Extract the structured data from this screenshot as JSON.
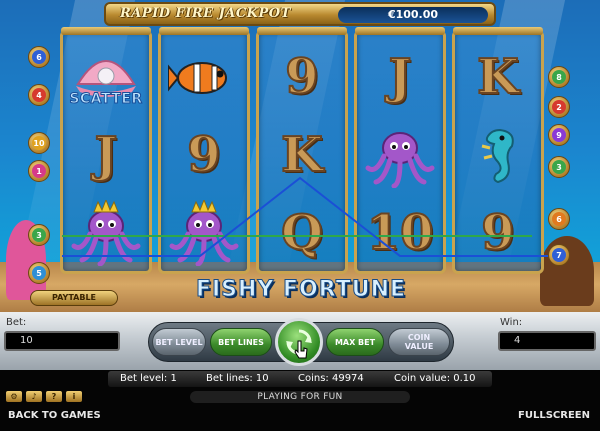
{
  "jackpot": {
    "title": "RAPID FIRE JACKPOT",
    "amount": "€100.00"
  },
  "game_title": "FISHY FORTUNE",
  "paytable_label": "PAYTABLE",
  "reels": [
    [
      {
        "type": "scatter",
        "label": "SCATTER"
      },
      {
        "type": "letter",
        "label": "J"
      },
      {
        "type": "octopus-king"
      }
    ],
    [
      {
        "type": "clownfish"
      },
      {
        "type": "letter",
        "label": "9"
      },
      {
        "type": "octopus-king"
      }
    ],
    [
      {
        "type": "letter",
        "label": "9"
      },
      {
        "type": "letter",
        "label": "K"
      },
      {
        "type": "letter",
        "label": "Q"
      }
    ],
    [
      {
        "type": "letter",
        "label": "J"
      },
      {
        "type": "octopus"
      },
      {
        "type": "letter",
        "label": "10"
      }
    ],
    [
      {
        "type": "letter",
        "label": "K"
      },
      {
        "type": "seahorse"
      },
      {
        "type": "letter",
        "label": "9"
      }
    ]
  ],
  "left_badges": [
    {
      "num": "6",
      "color": "#2f5fd6"
    },
    {
      "num": "4",
      "color": "#d63a2f"
    },
    {
      "num": "10",
      "color": "#e0a21f"
    },
    {
      "num": "1",
      "color": "#d63a8a"
    },
    {
      "num": "3",
      "color": "#3aa64a"
    },
    {
      "num": "5",
      "color": "#2f8fd6"
    }
  ],
  "right_badges": [
    {
      "num": "8",
      "color": "#3aa64a"
    },
    {
      "num": "2",
      "color": "#d63a2f"
    },
    {
      "num": "9",
      "color": "#8a3ad6"
    },
    {
      "num": "3",
      "color": "#3aa64a"
    },
    {
      "num": "6",
      "color": "#e07a1f"
    },
    {
      "num": "7",
      "color": "#2f5fd6"
    }
  ],
  "controls": {
    "bet_label": "Bet:",
    "bet_value": "10",
    "win_label": "Win:",
    "win_value": "4",
    "bet_level": "BET LEVEL",
    "bet_lines": "BET LINES",
    "spin": "SPIN",
    "max_bet": "MAX BET",
    "coin_value_line1": "COIN",
    "coin_value_line2": "VALUE"
  },
  "stats": {
    "bet_level": "Bet level: 1",
    "bet_lines": "Bet lines: 10",
    "coins": "Coins: 49974",
    "coin_value": "Coin value: 0.10"
  },
  "toolbar_icons": [
    "gear-icon",
    "sound-icon",
    "help-icon",
    "info-icon"
  ],
  "mode_text": "PLAYING FOR FUN",
  "back_label": "BACK TO GAMES",
  "fullscreen_label": "FULLSCREEN",
  "colors": {
    "payline_blue": "#1b4fd6",
    "payline_green": "#2fa84a",
    "reel_frame": "#c9a34e"
  }
}
